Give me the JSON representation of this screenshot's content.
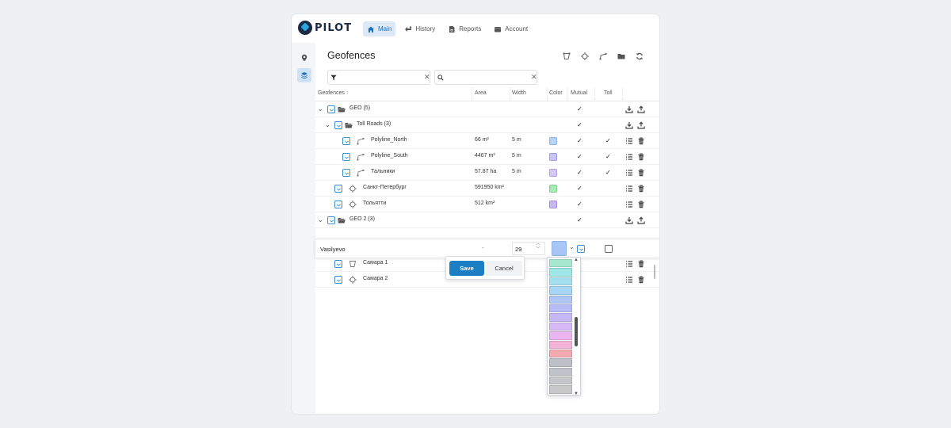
{
  "app": {
    "logo_text": "PILOT"
  },
  "nav": [
    {
      "label": "Main",
      "icon": "home-icon",
      "active": true
    },
    {
      "label": "History",
      "icon": "history-icon",
      "active": false
    },
    {
      "label": "Reports",
      "icon": "report-icon",
      "active": false
    },
    {
      "label": "Account",
      "icon": "account-icon",
      "active": false
    }
  ],
  "sidebar": {
    "items": [
      "location-pin-icon",
      "layers-icon"
    ]
  },
  "panel": {
    "title": "Geofences",
    "filter_placeholder": "",
    "search_placeholder": ""
  },
  "table": {
    "headers": {
      "geofences": "Geofences",
      "area": "Area",
      "width": "Width",
      "color": "Color",
      "mutual": "Mutual",
      "toll": "Toll"
    },
    "rows": [
      {
        "name": "GEO (5)",
        "type": "group"
      },
      {
        "name": "Toll Roads (3)",
        "type": "group"
      },
      {
        "name": "Polyline_North",
        "area": "66 m²",
        "width": "5 m"
      },
      {
        "name": "Polyline_South",
        "area": "4467 m²",
        "width": "5 m"
      },
      {
        "name": "Тальники",
        "area": "57.87 ha",
        "width": "5 m"
      },
      {
        "name": "Санкт-Петербург",
        "area": "591950 km²"
      },
      {
        "name": "Тольятти",
        "area": "512 km²"
      },
      {
        "name": "GEO 2 (3)",
        "type": "group"
      },
      {
        "name": "Самара 1"
      },
      {
        "name": "Самара 2",
        "area": "4990 km²"
      }
    ],
    "checkmark": "✓"
  },
  "edit_row": {
    "name_value": "Vasilyevo",
    "area_value": "-",
    "width_value": "29",
    "selected_color": "#a9c5f5"
  },
  "popover": {
    "save_label": "Save",
    "cancel_label": "Cancel"
  },
  "colors": {
    "accent": "#1c7fc6",
    "swatches": {
      "blue": "#b9d3f7",
      "periwinkle": "#c8c4f5",
      "lavender": "#d6c8f5",
      "green": "#a6ebb6",
      "purple": "#c9b8f0"
    },
    "palette": [
      "#a6e8cf",
      "#9fe6e6",
      "#a4e0f2",
      "#a7d6f5",
      "#aec6f6",
      "#b6bcf6",
      "#c6b8f6",
      "#d7b9f5",
      "#ebb5f2",
      "#f2b3d6",
      "#f4a9b1",
      "#bcc0c6",
      "#c0c4ca",
      "#c4c6c9",
      "#c8c8c8",
      "#cacaca"
    ]
  }
}
